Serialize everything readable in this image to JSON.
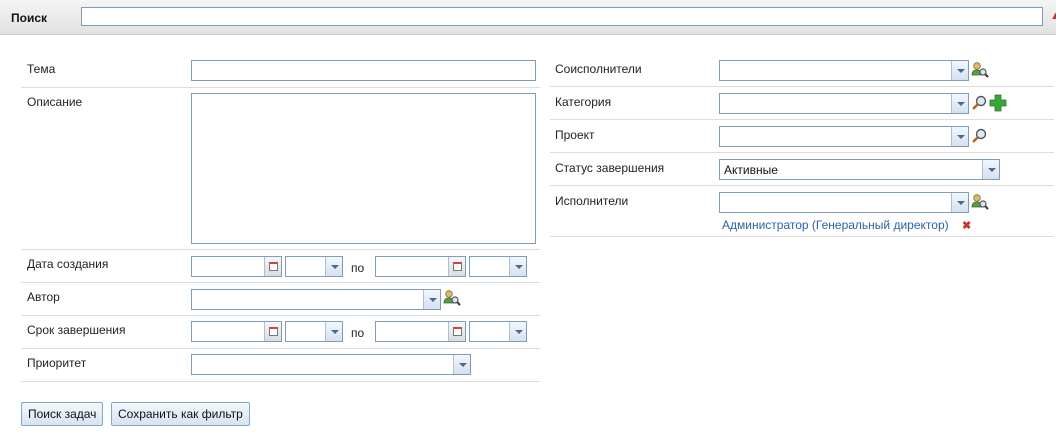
{
  "header": {
    "title": "Поиск",
    "search_value": ""
  },
  "left": {
    "topic_label": "Тема",
    "description_label": "Описание",
    "created_label": "Дата создания",
    "created_to": "по",
    "author_label": "Автор",
    "deadline_label": "Срок завершения",
    "deadline_to": "по",
    "priority_label": "Приоритет"
  },
  "right": {
    "coexecutors_label": "Соисполнители",
    "category_label": "Категория",
    "project_label": "Проект",
    "status_label": "Статус завершения",
    "status_value": "Активные",
    "executors_label": "Исполнители",
    "executor_link": "Администратор (Генеральный директор)",
    "remove_glyph": "✖"
  },
  "buttons": {
    "search": "Поиск задач",
    "save_filter": "Сохранить как фильтр"
  },
  "colors": {
    "link": "#2a62a6",
    "border": "#7f9db9",
    "add_green": "#3aa53a"
  }
}
